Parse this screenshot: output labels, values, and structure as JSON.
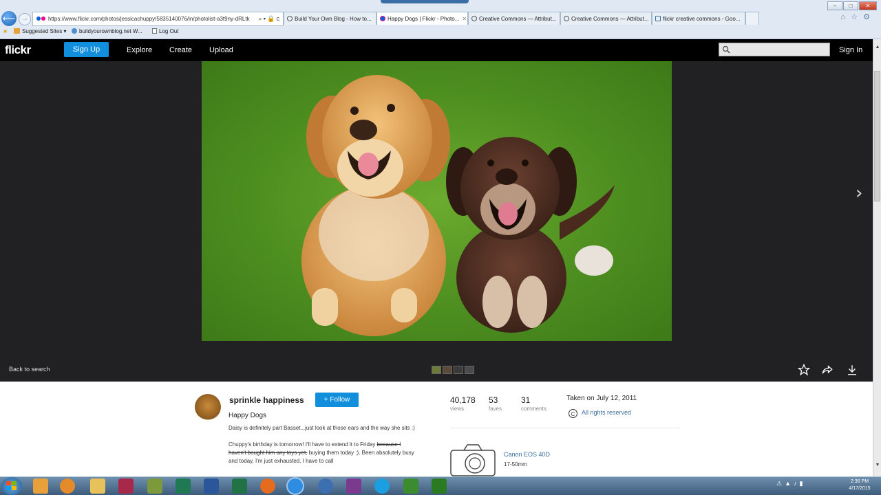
{
  "browser": {
    "address_url": "https://www.flickr.com/photos/jessicachuppy/5835140076/in/photolist-a3t9ny-dRLtk",
    "tabs": [
      {
        "label": "Build Your Own Blog - How to...",
        "active": false
      },
      {
        "label": "Happy Dogs | Flickr - Photo...",
        "active": true
      },
      {
        "label": "Creative Commons — Attribut...",
        "active": false
      },
      {
        "label": "Creative Commons — Attribut...",
        "active": false
      },
      {
        "label": "flickr creative commons - Goo...",
        "active": false
      }
    ],
    "favorites": [
      {
        "label": "Suggested Sites ▾"
      },
      {
        "label": "buildyourownblog.net W..."
      },
      {
        "label": "Log Out"
      }
    ]
  },
  "header": {
    "logo": "flickr",
    "signup_label": "Sign Up",
    "nav": [
      "Explore",
      "Create",
      "Upload"
    ],
    "search_placeholder": "",
    "signin_label": "Sign In"
  },
  "viewer": {
    "back_to_search": "Back to search",
    "thumbnail_count": 4
  },
  "photo_info": {
    "author": "sprinkle happiness",
    "follow_label": "+ Follow",
    "title": "Happy Dogs",
    "description_1": "Daisy is definitely part Basset...just look at those ears and the way she sits :)",
    "description_2_a": "Chuppy's birthday is tomorrow! I'll have to extend it to Friday",
    "description_2_strike": "because I haven't bought him any toys yet,",
    "description_2_b": "buying them today :). Been absolutely busy and today, I'm just exhausted. I have to call",
    "stats": [
      {
        "value": "40,178",
        "label": "views"
      },
      {
        "value": "53",
        "label": "faves"
      },
      {
        "value": "31",
        "label": "comments"
      }
    ],
    "taken": "Taken on July 12, 2011",
    "rights": "All rights reserved",
    "camera": "Canon EOS 40D",
    "lens": "17-50mm"
  },
  "taskbar": {
    "clock_time": "2:36 PM",
    "clock_date": "4/17/2015"
  },
  "colors": {
    "flickr_blue": "#128fdc",
    "page_dark": "#212124",
    "grass": "#5a9a26"
  }
}
